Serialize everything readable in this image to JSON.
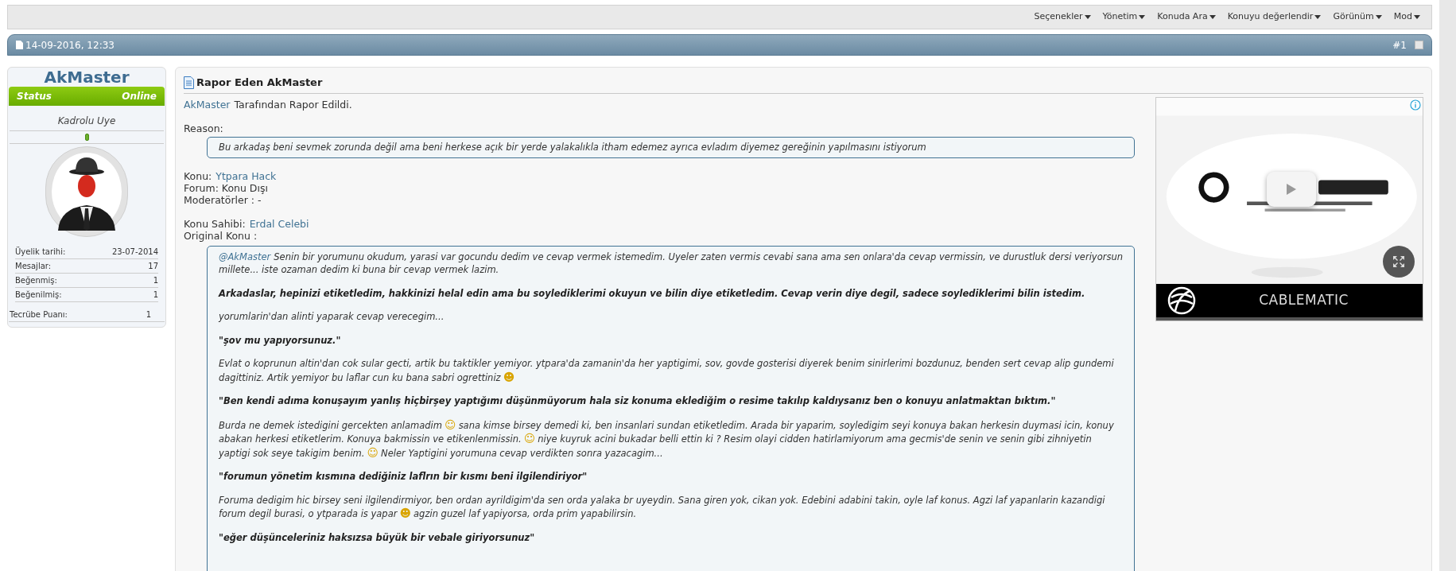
{
  "toolbar": {
    "menus": [
      "Seçenekler",
      "Yönetim",
      "Konuda Ara",
      "Konuyu değerlendir",
      "Görünüm",
      "Mod"
    ]
  },
  "post_header": {
    "date": "14-09-2016, 12:33",
    "number": "#1",
    "checked": false
  },
  "user": {
    "name": "AkMaster",
    "status_label": "Status",
    "status": "Online",
    "title": "Kadrolu Uye",
    "stats": [
      {
        "label": "Üyelik tarihi:",
        "value": "23-07-2014"
      },
      {
        "label": "Mesajlar:",
        "value": "17"
      },
      {
        "label": "Beğenmiş:",
        "value": "1"
      },
      {
        "label": "Beğenilmiş:",
        "value": "1"
      }
    ],
    "experience": {
      "label": "Tecrübe Puanı:",
      "value": "1"
    }
  },
  "post": {
    "title": "Rapor Eden AkMaster",
    "reporter_link": "AkMaster",
    "reporter_text": "Tarafından Rapor Edildi.",
    "reason_label": "Reason:",
    "reason": "Bu arkadaş beni sevmek zorunda değil ama beni herkese açık bir yerde yalakalıkla itham edemez ayrıca evladım diyemez gereğinin yapılmasını istiyorum",
    "info_groups": [
      [
        {
          "label": "Konu:",
          "link": "Ytpara Hack"
        },
        {
          "label": "Forum: Konu Dışı"
        },
        {
          "label": "Moderatörler : -"
        }
      ],
      [
        {
          "label": "Konu Sahibi:",
          "link": "Erdal Celebi"
        },
        {
          "label": "Original Konu :"
        }
      ]
    ],
    "quote": [
      {
        "bold": false,
        "parts": [
          {
            "kind": "mention",
            "text": "@AkMaster"
          },
          {
            "kind": "text",
            "text": "Senin bir yorumunu okudum, yarasi var gocundu dedim ve cevap vermek istemedim. Uyeler zaten vermis cevabi sana ama sen onlara'da cevap vermissin, ve durustluk dersi veriyorsun millete... iste ozaman dedim ki buna bir cevap vermek lazim."
          }
        ]
      },
      {
        "bold": true,
        "parts": [
          {
            "kind": "text",
            "text": "Arkadaslar, hepinizi etiketledim, hakkinizi helal edin ama bu soylediklerimi okuyun ve bilin diye etiketledim. Cevap verin diye degil, sadece soylediklerimi bilin istedim."
          }
        ]
      },
      {
        "bold": false,
        "parts": [
          {
            "kind": "text",
            "text": "yorumlarin'dan alinti yaparak cevap verecegim..."
          }
        ]
      },
      {
        "bold": true,
        "parts": [
          {
            "kind": "text",
            "text": "\"şov mu yapıyorsunuz.\""
          }
        ]
      },
      {
        "bold": false,
        "parts": [
          {
            "kind": "text",
            "text": "Evlat o koprunun altin'dan cok sular gecti, artik bu taktikler yemiyor. ytpara'da zamanin'da her yaptigimi, sov, govde gosterisi diyerek benim sinirlerimi bozdunuz, benden sert cevap alip gundemi dagittiniz. Artik yemiyor bu laflar cun ku bana sabri ogrettiniz"
          },
          {
            "kind": "emoji",
            "text": "☻"
          }
        ]
      },
      {
        "bold": true,
        "parts": [
          {
            "kind": "text",
            "text": "\"Ben kendi adıma konuşayım yanlış hiçbirşey yaptığımı düşünmüyorum hala siz konuma eklediğim o resime takılıp kaldıysanız ben o konuyu anlatmaktan bıktım.\""
          }
        ]
      },
      {
        "bold": false,
        "parts": [
          {
            "kind": "text",
            "text": "Burda ne demek istedigini gercekten anlamadim"
          },
          {
            "kind": "emoji",
            "text": "☺"
          },
          {
            "kind": "text",
            "text": "sana kimse birsey demedi ki, ben insanlari sundan etiketledim. Arada bir yaparim, soyledigim seyi konuya bakan herkesin duymasi icin, konuy abakan herkesi etiketlerim. Konuya bakmissin ve etikenlenmissin."
          },
          {
            "kind": "emoji",
            "text": "☺"
          },
          {
            "kind": "text",
            "text": "niye kuyruk acini bukadar belli ettin ki ? Resim olayi cidden hatirlamiyorum ama gecmis'de senin ve senin gibi zihniyetin yaptigi sok seye takigim benim."
          },
          {
            "kind": "emoji",
            "text": "☺"
          },
          {
            "kind": "text",
            "text": "Neler Yaptigini yorumuna cevap verdikten sonra yazacagim..."
          }
        ]
      },
      {
        "bold": true,
        "parts": [
          {
            "kind": "text",
            "text": "\"forumun yönetim kısmına dediğiniz laflrın bir kısmı beni ilgilendiriyor\""
          }
        ]
      },
      {
        "bold": false,
        "parts": [
          {
            "kind": "text",
            "text": "Foruma dedigim hic birsey seni ilgilendirmiyor, ben ordan ayrildigim'da sen orda yalaka br uyeydin. Sana giren yok, cikan yok. Edebini adabini takin, oyle laf konus. Agzi laf yapanlarin kazandigi forum degil burasi, o ytparada is yapar"
          },
          {
            "kind": "emoji",
            "text": "☻"
          },
          {
            "kind": "text",
            "text": "agzin guzel laf yapiyorsa, orda prim yapabilirsin."
          }
        ]
      },
      {
        "bold": true,
        "parts": [
          {
            "kind": "text",
            "text": "\"eğer düşünceleriniz haksızsa büyük bir vebale giriyorsunuz\""
          }
        ]
      }
    ]
  },
  "ad": {
    "brand": "CABLEMATIC"
  }
}
